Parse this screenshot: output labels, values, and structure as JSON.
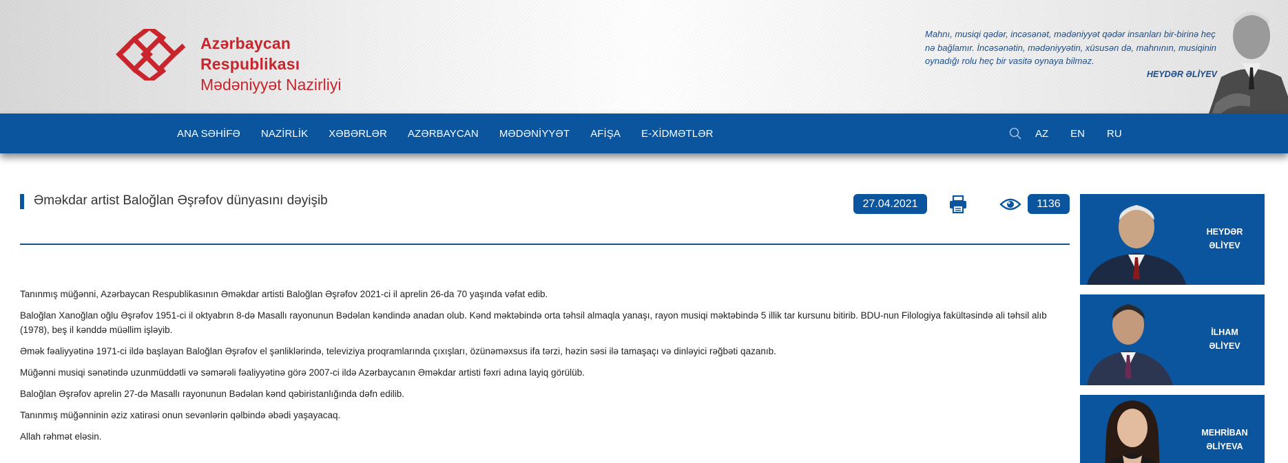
{
  "header": {
    "logo_line1": "Azərbaycan Respublikası",
    "logo_line2": "Mədəniyyət Nazirliyi",
    "quote": "Mahnı, musiqi qədər, incəsənət, mədəniyyət qədər insanları bir-birinə heç nə bağlamır. İncəsənətin, mədəniyyətin, xüsusən də, mahnının, musiqinin oynadığı rolu heç bir vasitə oynaya bilməz.",
    "quote_author": "HEYDƏR ƏLİYEV"
  },
  "nav": {
    "items": [
      "ANA SƏHİFƏ",
      "NAZİRLİK",
      "XƏBƏRLƏR",
      "AZƏRBAYCAN",
      "MƏDƏNİYYƏT",
      "AFİŞA",
      "E-XİDMƏTLƏR"
    ],
    "languages": [
      "AZ",
      "EN",
      "RU"
    ]
  },
  "article": {
    "title": "Əməkdar artist Baloğlan Əşrəfov dünyasını dəyişib",
    "date": "27.04.2021",
    "views": "1136",
    "paragraphs": [
      "Tanınmış müğənni, Azərbaycan Respublikasının Əməkdar artisti Baloğlan Əşrəfov 2021-ci il aprelin 26-da 70 yaşında vəfat edib.",
      "Baloğlan Xanoğlan oğlu Əşrəfov 1951-ci il oktyabrın 8-də Masallı rayonunun Bədəlan kəndində anadan olub. Kənd məktəbində orta təhsil almaqla yanaşı, rayon musiqi məktəbində 5 illik tar kursunu bitirib. BDU-nun Filologiya fakültəsində ali təhsil alıb (1978), beş il kənddə müəllim işləyib.",
      "Əmək fəaliyyətinə 1971-ci ildə başlayan Baloğlan Əşrəfov el şənliklərində, televiziya proqramlarında çıxışları, özünəməxsus ifa tərzi, həzin səsi ilə tamaşaçı və dinləyici rəğbəti qazanıb.",
      "Müğənni musiqi sənətində uzunmüddətli və səmərəli fəaliyyətinə görə 2007-ci ildə Azərbaycanın Əməkdar artisti fəxri adına layiq görülüb.",
      "Baloğlan Əşrəfov aprelin 27-də Masallı rayonunun Bədəlan kənd qəbiristanlığında dəfn edilib.",
      "Tanınmış müğənninin əziz xatirəsi onun sevənlərin qəlbində əbədi yaşayacaq.",
      "Allah rəhmət eləsin."
    ]
  },
  "sidebar": {
    "cards": [
      {
        "line1": "HEYDƏR",
        "line2": "ƏLİYEV"
      },
      {
        "line1": "İLHAM",
        "line2": "ƏLİYEV"
      },
      {
        "line1": "MEHRİBAN",
        "line2": "ƏLİYEVA"
      }
    ]
  },
  "colors": {
    "brand_blue": "#0b559e",
    "logo_red": "#c8252d",
    "quote_blue": "#1a4d8c"
  },
  "icons": [
    "logo-knot-icon",
    "search-icon",
    "print-icon",
    "eye-icon"
  ]
}
